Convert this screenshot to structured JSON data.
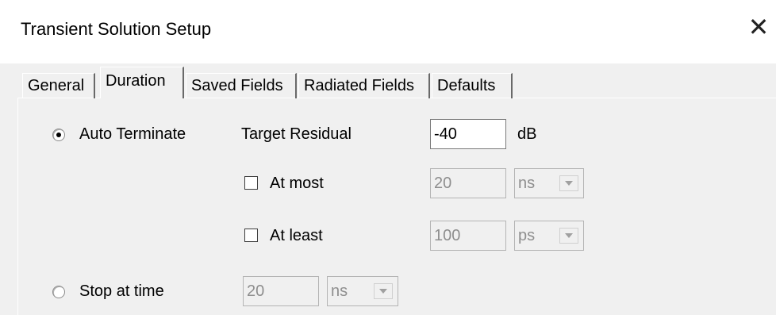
{
  "window": {
    "title": "Transient Solution Setup",
    "close_glyph": "✕"
  },
  "tabs": [
    {
      "label": "General",
      "active": false
    },
    {
      "label": "Duration",
      "active": true
    },
    {
      "label": "Saved Fields",
      "active": false
    },
    {
      "label": "Radiated Fields",
      "active": false
    },
    {
      "label": "Defaults",
      "active": false
    }
  ],
  "duration": {
    "auto_terminate": {
      "label": "Auto Terminate",
      "selected": true
    },
    "target_residual": {
      "label": "Target Residual",
      "value": "-40",
      "unit": "dB"
    },
    "at_most": {
      "label": "At most",
      "checked": false,
      "value": "20",
      "unit": "ns"
    },
    "at_least": {
      "label": "At least",
      "checked": false,
      "value": "100",
      "unit": "ps"
    },
    "stop_at_time": {
      "label": "Stop at time",
      "selected": false,
      "value": "20",
      "unit": "ns"
    }
  }
}
